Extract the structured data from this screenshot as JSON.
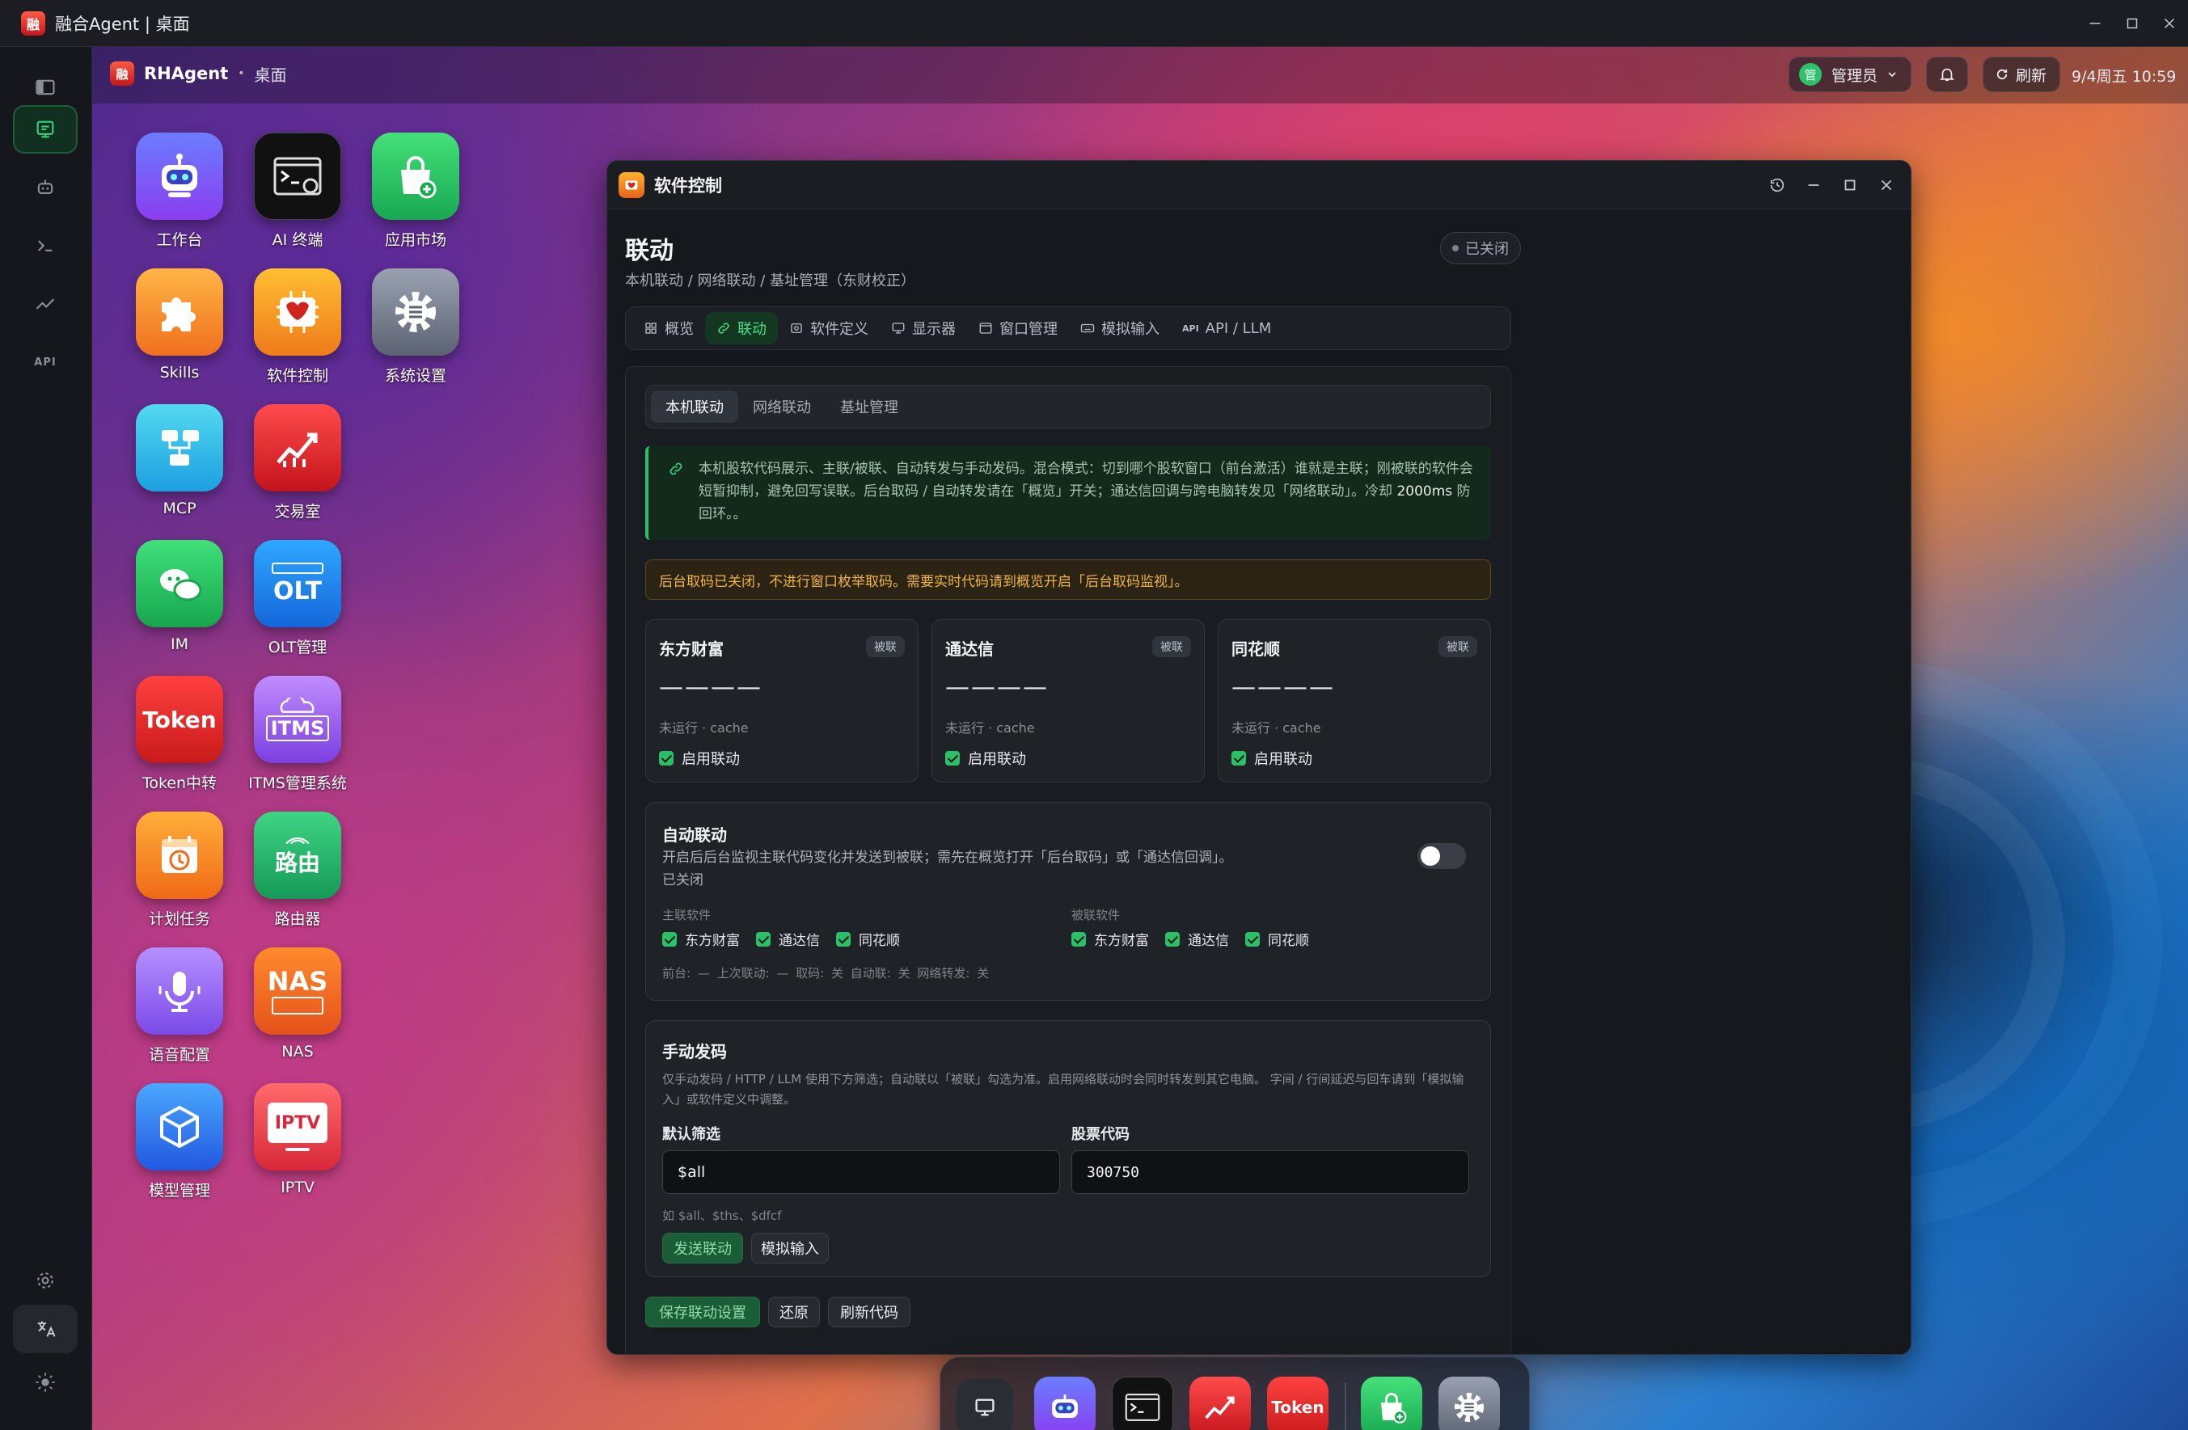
{
  "os": {
    "title": "融合Agent | 桌面",
    "logo_text": "融"
  },
  "rail": {
    "items": [
      "desktop-icon",
      "robot-icon",
      "terminal-icon",
      "chart-icon",
      "api-icon"
    ],
    "bottom": [
      "gear-icon",
      "translate-icon",
      "sun-icon"
    ],
    "api_text": "API"
  },
  "topbar": {
    "brand": "RHAgent",
    "crumb": "桌面",
    "admin_badge": "管",
    "admin_label": "管理员",
    "refresh_label": "刷新",
    "clock": "9/4周五 10:59"
  },
  "apps": [
    {
      "label": "工作台"
    },
    {
      "label": "AI 终端"
    },
    {
      "label": "应用市场"
    },
    {
      "label": "Skills"
    },
    {
      "label": "软件控制"
    },
    {
      "label": "系统设置"
    },
    {
      "label": "MCP"
    },
    {
      "label": "交易室"
    },
    {
      "label": "IM"
    },
    {
      "label": "OLT管理",
      "tile_text": "OLT"
    },
    {
      "label": "Token中转",
      "tile_text": "Token"
    },
    {
      "label": "ITMS管理系统",
      "tile_text": "ITMS"
    },
    {
      "label": "计划任务"
    },
    {
      "label": "路由器",
      "tile_text": "路由"
    },
    {
      "label": "语音配置"
    },
    {
      "label": "NAS",
      "tile_text": "NAS"
    },
    {
      "label": "模型管理"
    },
    {
      "label": "IPTV",
      "tile_text": "IPTV"
    }
  ],
  "window": {
    "title": "软件控制",
    "page_title": "联动",
    "status": "已关闭",
    "breadcrumb": "本机联动 / 网络联动 / 基址管理（东财校正）",
    "tabs": [
      {
        "label": "概览",
        "icon": "grid-icon"
      },
      {
        "label": "联动",
        "icon": "link-icon"
      },
      {
        "label": "软件定义",
        "icon": "box-icon"
      },
      {
        "label": "显示器",
        "icon": "monitor-icon"
      },
      {
        "label": "窗口管理",
        "icon": "window-icon"
      },
      {
        "label": "模拟输入",
        "icon": "keyboard-icon"
      },
      {
        "label": "API / LLM",
        "icon": "api-icon"
      }
    ],
    "api_tab_icon_text": "API",
    "subtabs": [
      "本机联动",
      "网络联动",
      "基址管理"
    ],
    "info_text_a": "本机股软代码展示、主联/被联、自动转发与手动发码。混合模式：切到哪个股软窗口（前台激活）谁就是主联；刚被联的软件会短暂抑制，避免回写误联。后台取码 / 自动转发请在「概览」开关；通达信回调与跨电脑转发见「网络联动」。冷却 ",
    "info_text_b": "2000ms",
    "info_text_c": " 防回环。。",
    "warning": "后台取码已关闭，不进行窗口枚举取码。需要实时代码请到概览开启「后台取码监视」。",
    "software": [
      {
        "name": "东方财富",
        "tag": "被联",
        "code": "————",
        "meta": "未运行 · cache",
        "check_label": "启用联动"
      },
      {
        "name": "通达信",
        "tag": "被联",
        "code": "————",
        "meta": "未运行 · cache",
        "check_label": "启用联动"
      },
      {
        "name": "同花顺",
        "tag": "被联",
        "code": "————",
        "meta": "未运行 · cache",
        "check_label": "启用联动"
      }
    ],
    "auto": {
      "title": "自动联动",
      "desc1": "开启后后台监视主联代码变化并发送到被联；需先在概览打开「后台取码」或「通达信回调」。",
      "desc2": "已关闭",
      "toggle_on": false,
      "master_label": "主联软件",
      "master": [
        "东方财富",
        "通达信",
        "同花顺"
      ],
      "slave_label": "被联软件",
      "slave": [
        "东方财富",
        "通达信",
        "同花顺"
      ],
      "status": "前台: — 上次联动: — 取码: 关 自动联: 关 网络转发: 关"
    },
    "manual": {
      "title": "手动发码",
      "desc": "仅手动发码 / HTTP / LLM 使用下方筛选；自动联以「被联」勾选为准。启用网络联动时会同时转发到其它电脑。 字间 / 行间延迟与回车请到「模拟输入」或软件定义中调整。",
      "filter_label": "默认筛选",
      "filter_value": "$all",
      "code_label": "股票代码",
      "code_value": "300750",
      "hint": "如 $all、$ths、$dfcf",
      "send_label": "发送联动",
      "simulate_label": "模拟输入"
    },
    "footer": {
      "save_label": "保存联动设置",
      "restore_label": "还原",
      "refresh_label": "刷新代码"
    }
  },
  "dock": {
    "items": [
      "desktop-icon",
      "workbench-icon",
      "ai-terminal-icon",
      "trading-icon",
      "token-icon",
      "app-market-icon",
      "settings-icon"
    ],
    "token_text": "Token"
  },
  "colors": {
    "accent": "#2bbf67",
    "warning": "#f0b43c",
    "window_bg": "#15181d"
  }
}
